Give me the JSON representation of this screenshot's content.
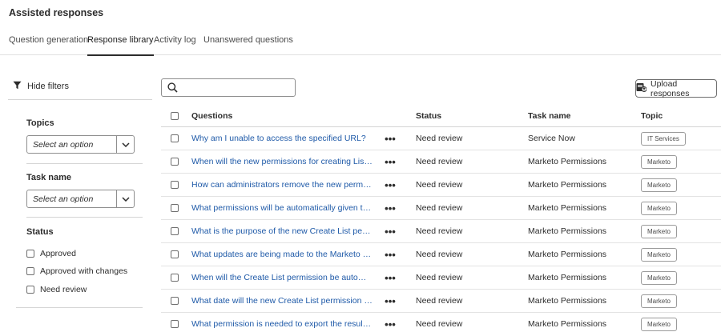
{
  "app": {
    "title": "Assisted responses"
  },
  "tabs": [
    {
      "label": "Question generation"
    },
    {
      "label": "Response library"
    },
    {
      "label": "Activity log"
    },
    {
      "label": "Unanswered questions"
    }
  ],
  "active_tab": "Response library",
  "filters": {
    "toggle_label": "Hide filters",
    "topics": {
      "heading": "Topics",
      "placeholder": "Select an option"
    },
    "task_name": {
      "heading": "Task name",
      "placeholder": "Select an option"
    },
    "status": {
      "heading": "Status",
      "options": [
        {
          "label": "Approved",
          "checked": false
        },
        {
          "label": "Approved with changes",
          "checked": false
        },
        {
          "label": "Need review",
          "checked": false
        }
      ]
    }
  },
  "search": {
    "value": "",
    "placeholder": ""
  },
  "upload_button": {
    "label": "Upload responses"
  },
  "table": {
    "columns": {
      "questions": "Questions",
      "status": "Status",
      "task_name": "Task name",
      "topic": "Topic"
    },
    "rows": [
      {
        "question": "Why am I unable to access the specified URL?",
        "status": "Need review",
        "task_name": "Service Now",
        "topic": "IT Services"
      },
      {
        "question": "When will the new permissions for creating Lists/Smar...",
        "status": "Need review",
        "task_name": "Marketo Permissions",
        "topic": "Marketo"
      },
      {
        "question": "How can administrators remove the new permissions ...",
        "status": "Need review",
        "task_name": "Marketo Permissions",
        "topic": "Marketo"
      },
      {
        "question": "What permissions will be automatically given to users ...",
        "status": "Need review",
        "task_name": "Marketo Permissions",
        "topic": "Marketo"
      },
      {
        "question": "What is the purpose of the new Create List permission ...",
        "status": "Need review",
        "task_name": "Marketo Permissions",
        "topic": "Marketo"
      },
      {
        "question": "What updates are being made to the Marketo Engage ...",
        "status": "Need review",
        "task_name": "Marketo Permissions",
        "topic": "Marketo"
      },
      {
        "question": "When will the Create List permission be automatically ...",
        "status": "Need review",
        "task_name": "Marketo Permissions",
        "topic": "Marketo"
      },
      {
        "question": "What date will the new Create List permission be enfo...",
        "status": "Need review",
        "task_name": "Marketo Permissions",
        "topic": "Marketo"
      },
      {
        "question": "What permission is needed to export the results of Sm...",
        "status": "Need review",
        "task_name": "Marketo Permissions",
        "topic": "Marketo"
      }
    ],
    "row_menu_glyph": "•••"
  },
  "icons": {
    "filter": "filter-icon",
    "chevron": "chevron-down-icon",
    "search": "search-icon",
    "upload": "upload-icon",
    "more": "more-icon"
  },
  "colors": {
    "link": "#1f5aa8",
    "text": "#2c2c2c",
    "border": "#8e8e8e"
  }
}
